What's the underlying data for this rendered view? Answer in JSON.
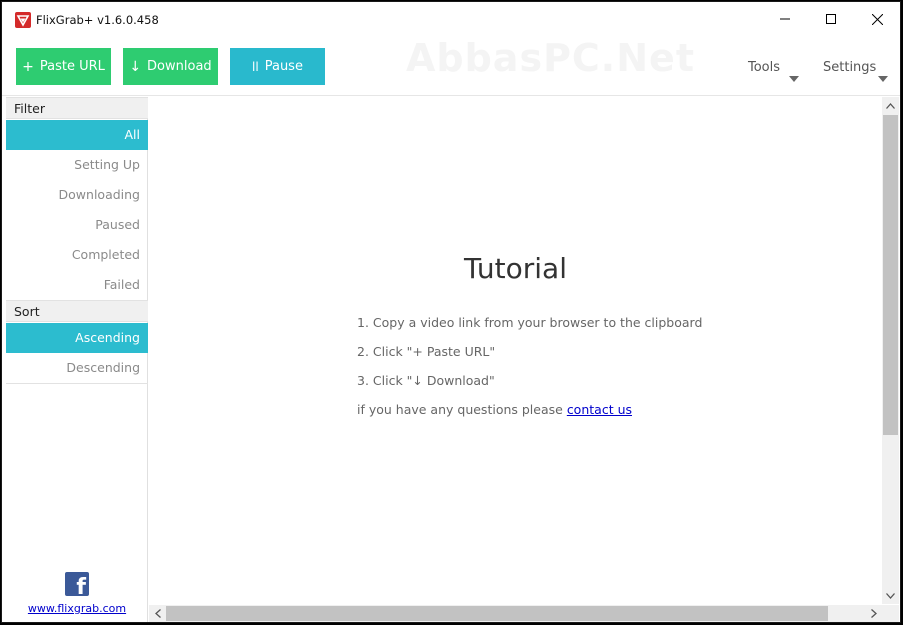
{
  "window": {
    "title": "FlixGrab+ v1.6.0.458",
    "controls": {
      "minimize": "minimize",
      "maximize": "maximize",
      "close": "close"
    }
  },
  "toolbar": {
    "paste_label": "Paste URL",
    "paste_glyph": "+",
    "download_label": "Download",
    "download_glyph": "↓",
    "pause_label": "Pause",
    "pause_glyph": "ll",
    "watermark": "AbbasPC.Net",
    "tools_label": "Tools",
    "settings_label": "Settings"
  },
  "sidebar": {
    "filter_header": "Filter",
    "filter_items": [
      "All",
      "Setting Up",
      "Downloading",
      "Paused",
      "Completed",
      "Failed"
    ],
    "filter_active": "All",
    "sort_header": "Sort",
    "sort_items": [
      "Ascending",
      "Descending"
    ],
    "sort_active": "Ascending",
    "site_link": "www.flixgrab.com",
    "social_icon": "facebook-icon"
  },
  "main": {
    "title": "Tutorial",
    "step1": "1. Copy a video link from your browser to the clipboard",
    "step2": "2. Click \"+ Paste URL\"",
    "step3": "3. Click \"↓ Download\"",
    "question_prefix": "if you have any questions please ",
    "contact_link": "contact us"
  },
  "colors": {
    "green": "#2ecc71",
    "teal": "#29b9cd",
    "active_item": "#2cbccf",
    "link": "#0000cc",
    "facebook": "#3b5998"
  }
}
